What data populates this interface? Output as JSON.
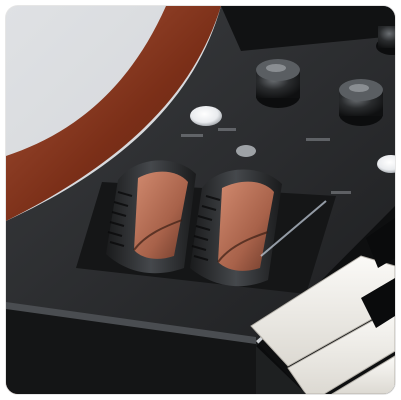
{
  "photo": {
    "subject": "synth-keyboard-pitch-mod-wheels-photo",
    "colors": {
      "background": "#d6d8db",
      "wood": "#8a3a20",
      "panel": "#2a2c2e",
      "wheel": "#3a3d40",
      "wheel_insert": "#b86f55",
      "key_white": "#f3f1ec",
      "key_black": "#111213"
    }
  }
}
